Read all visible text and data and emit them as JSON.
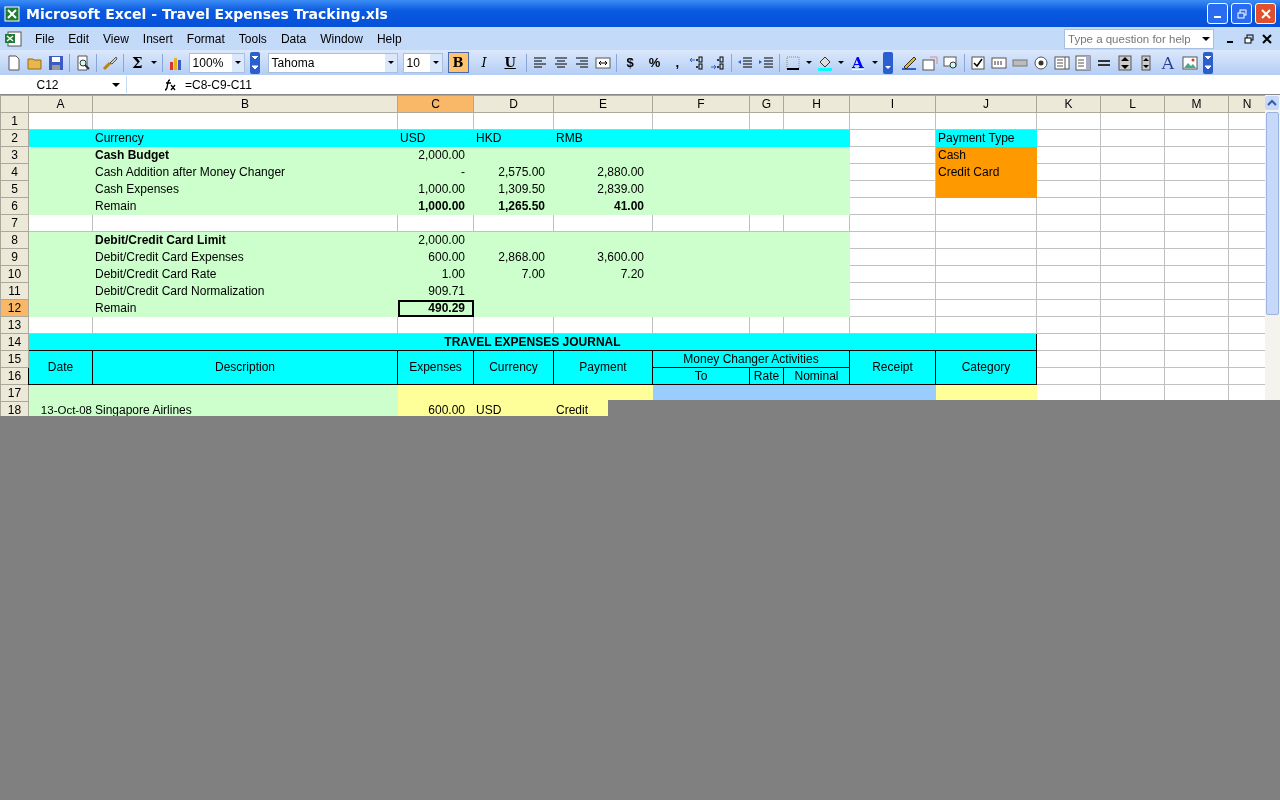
{
  "window": {
    "title": "Microsoft Excel - Travel Expenses Tracking.xls"
  },
  "menu": [
    "File",
    "Edit",
    "View",
    "Insert",
    "Format",
    "Tools",
    "Data",
    "Window",
    "Help"
  ],
  "help_box": {
    "placeholder": "Type a question for help"
  },
  "toolbar": {
    "autosum": "Σ",
    "zoom": "100%",
    "font": "Tahoma",
    "font_size": "10",
    "styles": [
      {
        "label": "B",
        "selected": true
      },
      {
        "label": "I",
        "selected": false
      },
      {
        "label": "U",
        "selected": false
      }
    ],
    "number_formats": [
      "$",
      "%",
      ","
    ],
    "font_color": "A",
    "label_control": "A"
  },
  "formula_bar": {
    "name_box": "C12",
    "formula": "=C8-C9-C11"
  },
  "sheet": {
    "columns": [
      {
        "letter": "A",
        "selected": false
      },
      {
        "letter": "B",
        "selected": false
      },
      {
        "letter": "C",
        "selected": true
      },
      {
        "letter": "D",
        "selected": false
      },
      {
        "letter": "E",
        "selected": false
      },
      {
        "letter": "F",
        "selected": false
      },
      {
        "letter": "G",
        "selected": false
      },
      {
        "letter": "H",
        "selected": false
      },
      {
        "letter": "I",
        "selected": false
      },
      {
        "letter": "J",
        "selected": false
      },
      {
        "letter": "K",
        "selected": false
      },
      {
        "letter": "L",
        "selected": false
      },
      {
        "letter": "M",
        "selected": false
      },
      {
        "letter": "N",
        "selected": false
      }
    ],
    "rows": [
      {
        "number": "1",
        "kind": "blank",
        "selected": false
      },
      {
        "number": "2",
        "kind": "currency-header",
        "selected": false,
        "cells": {
          "B": {
            "kind": "label",
            "text": "Currency",
            "selected": false
          },
          "C": {
            "kind": "label",
            "text": "USD",
            "selected": false
          },
          "D": {
            "kind": "label",
            "text": "HKD",
            "selected": false
          },
          "E": {
            "kind": "label",
            "text": "RMB",
            "selected": false
          },
          "J": {
            "kind": "list-header",
            "text": "Payment Type",
            "selected": false
          }
        }
      },
      {
        "number": "3",
        "kind": "summary",
        "selected": false,
        "cells": {
          "B": {
            "kind": "heading",
            "text": "Cash Budget",
            "selected": false
          },
          "C": {
            "kind": "amount",
            "text": "2,000.00",
            "selected": false
          },
          "J": {
            "kind": "list-item",
            "text": "Cash",
            "selected": false
          }
        }
      },
      {
        "number": "4",
        "kind": "summary",
        "selected": false,
        "cells": {
          "B": {
            "kind": "label",
            "text": "Cash Addition after Money Changer",
            "selected": false
          },
          "C": {
            "kind": "amount",
            "text": "-",
            "selected": false
          },
          "D": {
            "kind": "amount",
            "text": "2,575.00",
            "selected": false
          },
          "E": {
            "kind": "amount",
            "text": "2,880.00",
            "selected": false
          },
          "J": {
            "kind": "list-item",
            "text": "Credit Card",
            "selected": false
          }
        }
      },
      {
        "number": "5",
        "kind": "summary",
        "selected": false,
        "cells": {
          "B": {
            "kind": "label",
            "text": "Cash Expenses",
            "selected": false
          },
          "C": {
            "kind": "amount",
            "text": "1,000.00",
            "selected": false
          },
          "D": {
            "kind": "amount",
            "text": "1,309.50",
            "selected": false
          },
          "E": {
            "kind": "amount",
            "text": "2,839.00",
            "selected": false
          },
          "J": {
            "kind": "list-item",
            "selected": false
          }
        }
      },
      {
        "number": "6",
        "kind": "summary",
        "selected": false,
        "cells": {
          "B": {
            "kind": "label",
            "text": "Remain",
            "selected": false
          },
          "C": {
            "kind": "total",
            "text": "1,000.00",
            "selected": false
          },
          "D": {
            "kind": "total",
            "text": "1,265.50",
            "selected": false
          },
          "E": {
            "kind": "total",
            "text": "41.00",
            "selected": false
          }
        }
      },
      {
        "number": "7",
        "kind": "blank",
        "selected": false
      },
      {
        "number": "8",
        "kind": "summary",
        "selected": false,
        "cells": {
          "B": {
            "kind": "heading",
            "text": "Debit/Credit Card Limit",
            "selected": false
          },
          "C": {
            "kind": "amount",
            "text": "2,000.00",
            "selected": false
          }
        }
      },
      {
        "number": "9",
        "kind": "summary",
        "selected": false,
        "cells": {
          "B": {
            "kind": "label",
            "text": "Debit/Credit Card Expenses",
            "selected": false
          },
          "C": {
            "kind": "amount",
            "text": "600.00",
            "selected": false
          },
          "D": {
            "kind": "amount",
            "text": "2,868.00",
            "selected": false
          },
          "E": {
            "kind": "amount",
            "text": "3,600.00",
            "selected": false
          }
        }
      },
      {
        "number": "10",
        "kind": "summary",
        "selected": false,
        "cells": {
          "B": {
            "kind": "label",
            "text": "Debit/Credit Card Rate",
            "selected": false
          },
          "C": {
            "kind": "amount",
            "text": "1.00",
            "selected": false
          },
          "D": {
            "kind": "amount",
            "text": "7.00",
            "selected": false
          },
          "E": {
            "kind": "amount",
            "text": "7.20",
            "selected": false
          }
        }
      },
      {
        "number": "11",
        "kind": "summary",
        "selected": false,
        "cells": {
          "B": {
            "kind": "label",
            "text": "Debit/Credit Card Normalization",
            "selected": false
          },
          "C": {
            "kind": "amount",
            "text": "909.71",
            "selected": false
          }
        }
      },
      {
        "number": "12",
        "kind": "summary",
        "selected": true,
        "cells": {
          "B": {
            "kind": "label",
            "text": "Remain",
            "selected": false
          },
          "C": {
            "kind": "total",
            "text": "490.29",
            "selected": true
          }
        }
      },
      {
        "number": "13",
        "kind": "blank",
        "selected": false
      },
      {
        "number": "14",
        "kind": "journal-title",
        "selected": false,
        "title": "TRAVEL EXPENSES JOURNAL"
      },
      {
        "number": "15",
        "kind": "journal-header",
        "selected": false,
        "headers": [
          {
            "label": "Date"
          },
          {
            "label": "Description"
          },
          {
            "label": "Expenses"
          },
          {
            "label": "Currency"
          },
          {
            "label": "Payment"
          },
          {
            "label": "Money Changer Activities",
            "children": [
              "To",
              "Rate",
              "Nominal"
            ]
          },
          {
            "label": "Receipt"
          },
          {
            "label": "Category"
          }
        ]
      },
      {
        "number": "16",
        "kind": "journal-subheader",
        "selected": false
      },
      {
        "number": "17",
        "kind": "entry",
        "selected": false
      },
      {
        "number": "18",
        "kind": "entry",
        "selected": false,
        "cells": {
          "A": {
            "kind": "date",
            "text": "13-Oct-08",
            "selected": false
          },
          "B": {
            "kind": "label",
            "text": "Singapore Airlines",
            "selected": false
          },
          "C": {
            "kind": "amount",
            "text": "600.00",
            "selected": false
          },
          "D": {
            "kind": "label",
            "text": "USD",
            "selected": false
          },
          "E": {
            "kind": "label",
            "text": "Credit",
            "selected": false
          }
        }
      }
    ]
  }
}
